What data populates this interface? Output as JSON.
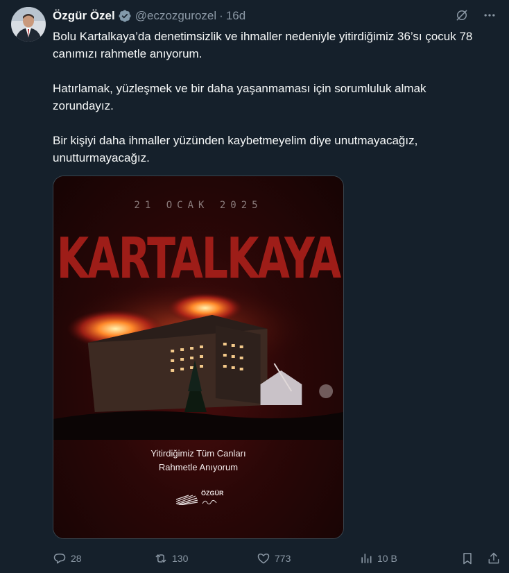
{
  "author": {
    "name": "Özgür Özel",
    "handle": "@eczozgurozel",
    "time": "16d",
    "separator": "·"
  },
  "tweet": {
    "paragraphs": [
      "Bolu Kartalkaya’da denetimsizlik ve ihmaller nedeniyle yitirdiğimiz 36’sı çocuk 78 canımızı rahmetle anıyorum.",
      "Hatırlamak, yüzleşmek ve bir daha yaşanmaması için sorumluluk almak zorundayız.",
      "Bir kişiyi daha ihmaller yüzünden kaybetmeyelim diye unutmayacağız, unutturmayacağız."
    ]
  },
  "poster": {
    "date": "21 OCAK 2025",
    "title": "KARTALKAYA",
    "caption_line1": "Yitirdiğimiz Tüm Canları",
    "caption_line2": "Rahmetle Anıyorum",
    "logo_text": "ÖZGÜR"
  },
  "actions": {
    "replies": "28",
    "reposts": "130",
    "likes": "773",
    "views": "10 B"
  },
  "colors": {
    "background": "#15202b",
    "text": "#f7f9f9",
    "muted": "#8b98a5",
    "verified": "#829aab",
    "poster_title": "#9e1d18"
  },
  "icons": {
    "verified": "verified-badge-icon",
    "grok": "grok-icon",
    "more": "more-icon",
    "reply": "reply-icon",
    "repost": "repost-icon",
    "like": "heart-icon",
    "views": "views-icon",
    "bookmark": "bookmark-icon",
    "share": "share-icon"
  }
}
